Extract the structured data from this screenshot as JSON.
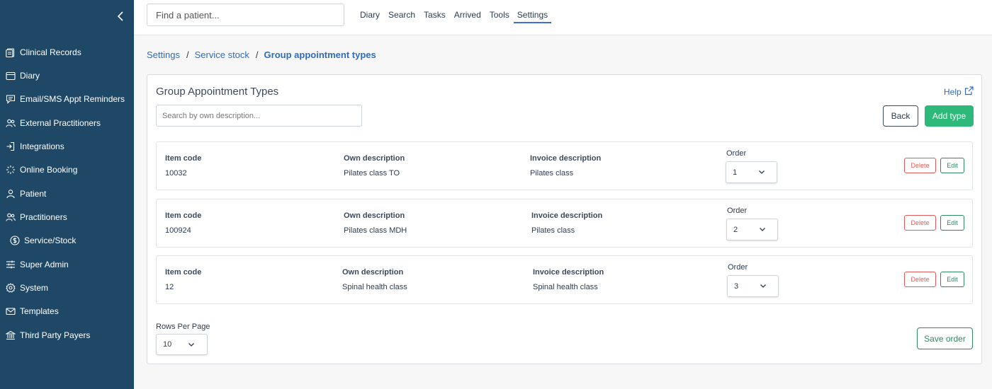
{
  "sidebar": {
    "collapse_icon": "chevron-left-icon",
    "items": [
      {
        "label": "Clinical Records",
        "icon": "clipboard-icon"
      },
      {
        "label": "Diary",
        "icon": "calendar-icon"
      },
      {
        "label": "Email/SMS Appt Reminders",
        "icon": "message-icon"
      },
      {
        "label": "External Practitioners",
        "icon": "users-icon"
      },
      {
        "label": "Integrations",
        "icon": "login-icon"
      },
      {
        "label": "Online Booking",
        "icon": "loader-icon"
      },
      {
        "label": "Patient",
        "icon": "user-icon"
      },
      {
        "label": "Practitioners",
        "icon": "users-icon"
      },
      {
        "label": "Service/Stock",
        "icon": "dollar-icon"
      },
      {
        "label": "Super Admin",
        "icon": "sliders-icon"
      },
      {
        "label": "System",
        "icon": "gear-icon"
      },
      {
        "label": "Templates",
        "icon": "mail-icon"
      },
      {
        "label": "Third Party Payers",
        "icon": "bank-icon"
      }
    ]
  },
  "header": {
    "search_placeholder": "Find a patient...",
    "nav": [
      "Diary",
      "Search",
      "Tasks",
      "Arrived",
      "Tools",
      "Settings"
    ],
    "active_nav": "Settings"
  },
  "breadcrumb": {
    "items": [
      "Settings",
      "Service stock"
    ],
    "current": "Group appointment types"
  },
  "main": {
    "title": "Group Appointment Types",
    "help_label": "Help",
    "search_placeholder": "Search by own description...",
    "back_label": "Back",
    "add_label": "Add type",
    "columns": {
      "item_code": "Item code",
      "own_description": "Own description",
      "invoice_description": "Invoice description",
      "order": "Order"
    },
    "rows": [
      {
        "item_code": "10032",
        "own_description": "Pilates class TO",
        "invoice_description": "Pilates class",
        "order": "1"
      },
      {
        "item_code": "100924",
        "own_description": "Pilates class MDH",
        "invoice_description": "Pilates class",
        "order": "2"
      },
      {
        "item_code": "12",
        "own_description": "Spinal health class",
        "invoice_description": "Spinal health class",
        "order": "3"
      }
    ],
    "delete_label": "Delete",
    "edit_label": "Edit",
    "rows_per_page_label": "Rows Per Page",
    "rows_per_page_value": "10",
    "save_order_label": "Save order"
  },
  "colors": {
    "sidebar_bg": "#1f4866",
    "link": "#2f6bbf",
    "primary_green": "#2db97a",
    "danger": "#e25b5b"
  }
}
